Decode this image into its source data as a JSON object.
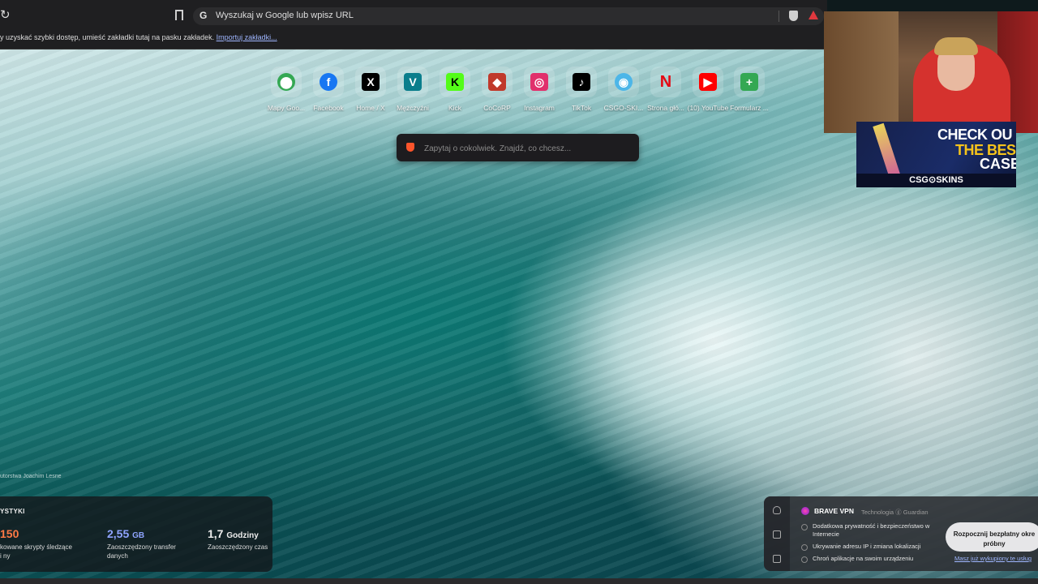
{
  "toolbar": {
    "address_placeholder": "Wyszukaj w Google lub wpisz URL",
    "google_glyph": "G",
    "reload_glyph": "↻"
  },
  "bookmarks_bar": {
    "hint": "y uzyskać szybki dostęp, umieść zakładki tutaj na pasku zakładek.",
    "import_link": "Importuj zakładki..."
  },
  "top_sites": [
    {
      "label": "Mapy Goo...",
      "icon": "google-maps-icon",
      "glyph": "⬤",
      "color": "#34a853"
    },
    {
      "label": "Facebook",
      "icon": "facebook-icon",
      "glyph": "f",
      "color": "#1877f2"
    },
    {
      "label": "Home / X",
      "icon": "x-icon",
      "glyph": "X",
      "color": "#000000"
    },
    {
      "label": "Mężczyźni",
      "icon": "vinted-icon",
      "glyph": "V",
      "color": "#0a7e8c"
    },
    {
      "label": "Kick",
      "icon": "kick-icon",
      "glyph": "K",
      "color": "#53fc18"
    },
    {
      "label": "CoCoRP",
      "icon": "cocorp-icon",
      "glyph": "◆",
      "color": "#c0392b"
    },
    {
      "label": "Instagram",
      "icon": "instagram-icon",
      "glyph": "◎",
      "color": "#e1306c"
    },
    {
      "label": "TikTok",
      "icon": "tiktok-icon",
      "glyph": "♪",
      "color": "#000000"
    },
    {
      "label": "CSGO-SKI...",
      "icon": "csgo-skins-icon",
      "glyph": "◉",
      "color": "#4db6e8"
    },
    {
      "label": "Strona głó...",
      "icon": "netflix-icon",
      "glyph": "N",
      "color": "#e50914"
    },
    {
      "label": "(10) YouTube",
      "icon": "youtube-icon",
      "glyph": "▶",
      "color": "#ff0000"
    },
    {
      "label": "Formularz ...",
      "icon": "forms-plus-icon",
      "glyph": "+",
      "color": "#34a853"
    }
  ],
  "search": {
    "placeholder": "Zapytaj o cokolwiek. Znajdź, co chcesz..."
  },
  "promo": {
    "line1": "CHECK OU",
    "line2": "THE BES",
    "line3": "CASE",
    "brand": "CSG⊙SKINS"
  },
  "photo_credit": "utorstwa Joachim Lesne",
  "stats": {
    "title": "YSTYKI",
    "items": [
      {
        "value": "150",
        "unit": "",
        "desc": "kowane skrypty śledzące i ny",
        "color": "#ff7a45"
      },
      {
        "value": "2,55",
        "unit": "GB",
        "desc": "Zaoszczędzony transfer danych",
        "color": "#8fa4ff"
      },
      {
        "value": "1,7",
        "unit": "Godziny",
        "desc": "Zaoszczędzony czas",
        "color": "#ffffff"
      }
    ]
  },
  "vpn": {
    "title": "BRAVE VPN",
    "tech": "Technologia ⓖ Guardian",
    "features": [
      "Dodatkowa prywatność i bezpieczeństwo w Internecie",
      "Ukrywanie adresu IP i zmiana lokalizacji",
      "Chroń aplikacje na swoim urządzeniu"
    ],
    "cta": "Rozpocznij bezpłatny okre próbny",
    "link": "Masz już wykupiony te usług"
  }
}
